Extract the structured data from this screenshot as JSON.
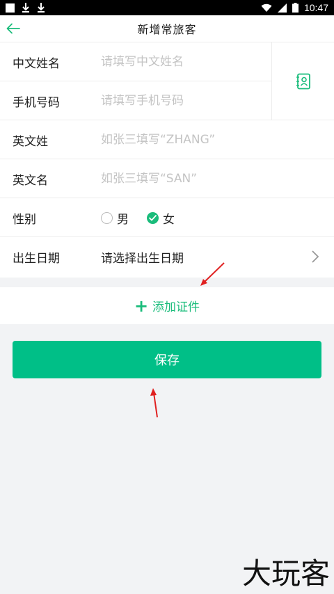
{
  "status_bar": {
    "time": "10:47"
  },
  "header": {
    "title": "新增常旅客"
  },
  "form": {
    "chinese_name": {
      "label": "中文姓名",
      "placeholder": "请填写中文姓名"
    },
    "phone": {
      "label": "手机号码",
      "placeholder": "请填写手机号码"
    },
    "english_surname": {
      "label": "英文姓",
      "placeholder": "如张三填写“ZHANG”"
    },
    "english_given": {
      "label": "英文名",
      "placeholder": "如张三填写“SAN”"
    },
    "gender": {
      "label": "性别",
      "options": [
        "男",
        "女"
      ],
      "selected": "女"
    },
    "birth_date": {
      "label": "出生日期",
      "value": "请选择出生日期"
    }
  },
  "add_certificate": {
    "label": "添加证件"
  },
  "save": {
    "label": "保存"
  },
  "watermark": {
    "text": "大玩客"
  },
  "colors": {
    "accent": "#00bf87",
    "text": "#222222",
    "placeholder": "#c4c4c4",
    "arrow": "#e02020"
  }
}
